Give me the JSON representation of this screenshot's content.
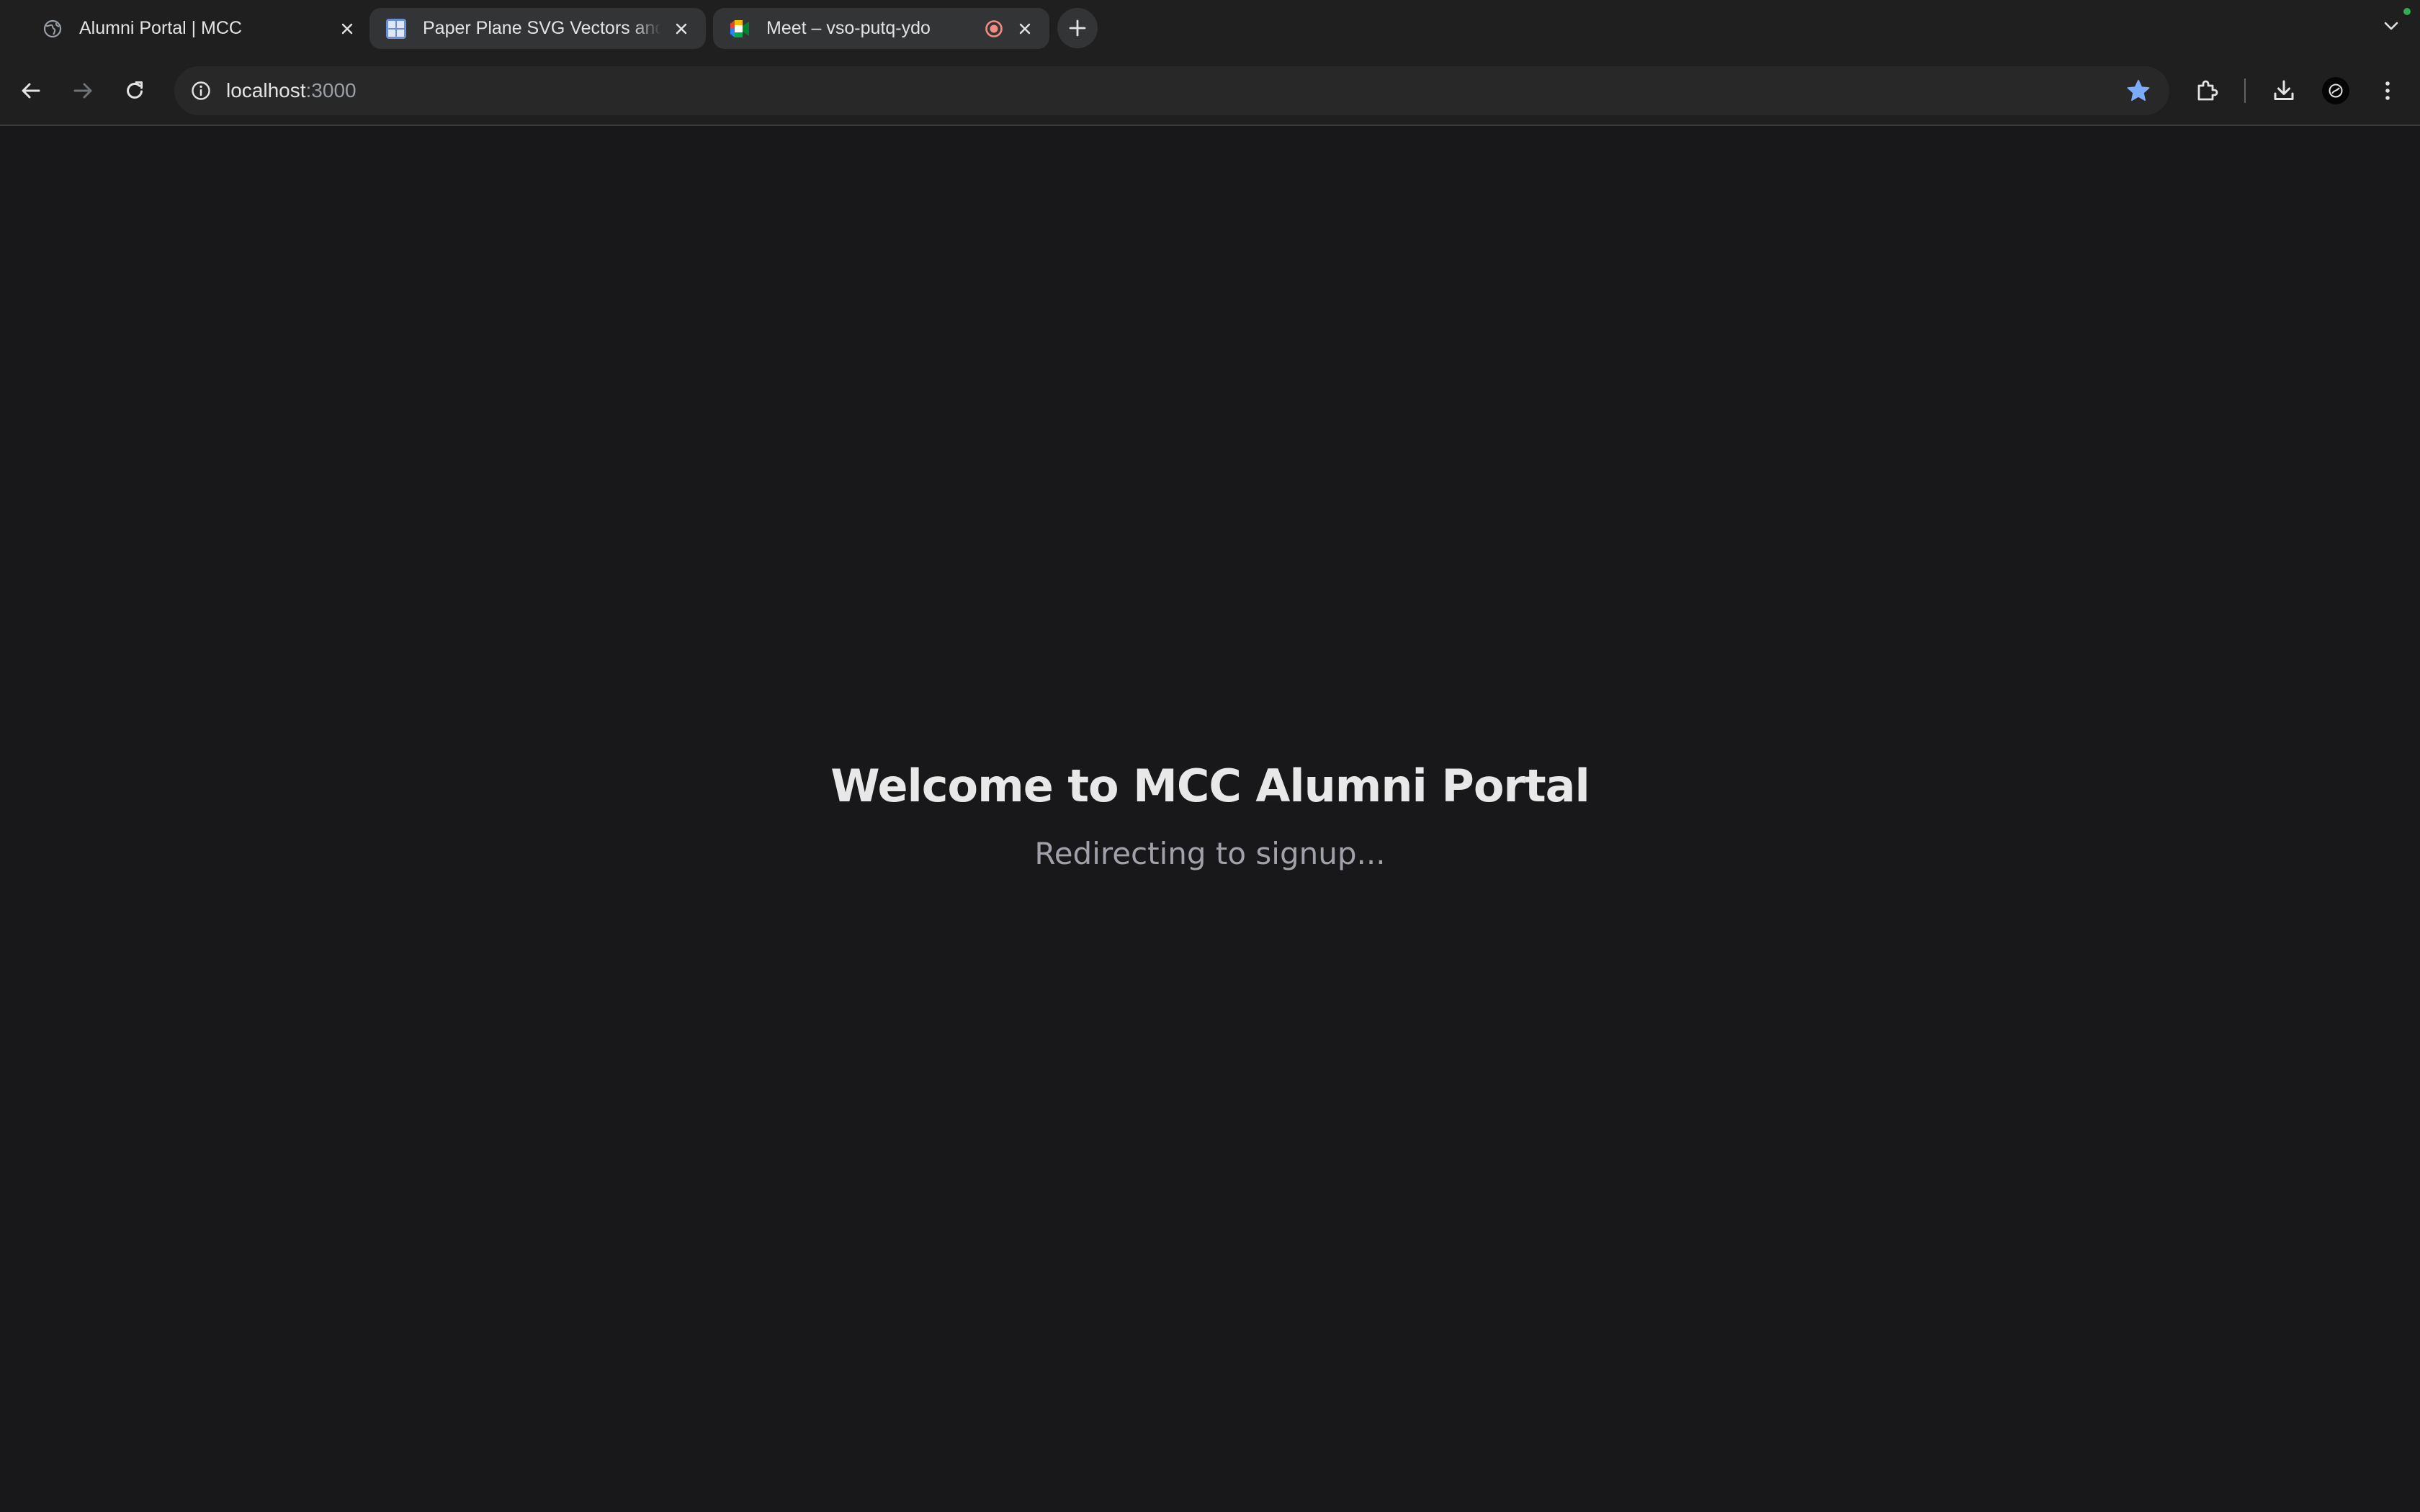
{
  "browser": {
    "tabs": [
      {
        "title": "Alumni Portal | MCC",
        "favicon": "globe-icon",
        "active": true
      },
      {
        "title": "Paper Plane SVG Vectors and",
        "favicon": "svgrepo-icon",
        "active": false
      },
      {
        "title": "Meet – vso-putq-ydo",
        "favicon": "google-meet-icon",
        "active": false,
        "recording": true
      }
    ],
    "url": {
      "host": "localhost",
      "port": ":3000"
    },
    "bookmarked": true,
    "colors": {
      "frame": "#1f1f1f",
      "inactive_tab": "#333436",
      "omnibox": "#282828",
      "bookmark_star": "#7cacf8",
      "recording": "#f28b82"
    }
  },
  "page": {
    "heading": "Welcome to MCC Alumni Portal",
    "subheading": "Redirecting to signup...",
    "colors": {
      "background": "#18181b",
      "heading": "#e8e8e8",
      "subheading": "#a1a1aa"
    }
  }
}
